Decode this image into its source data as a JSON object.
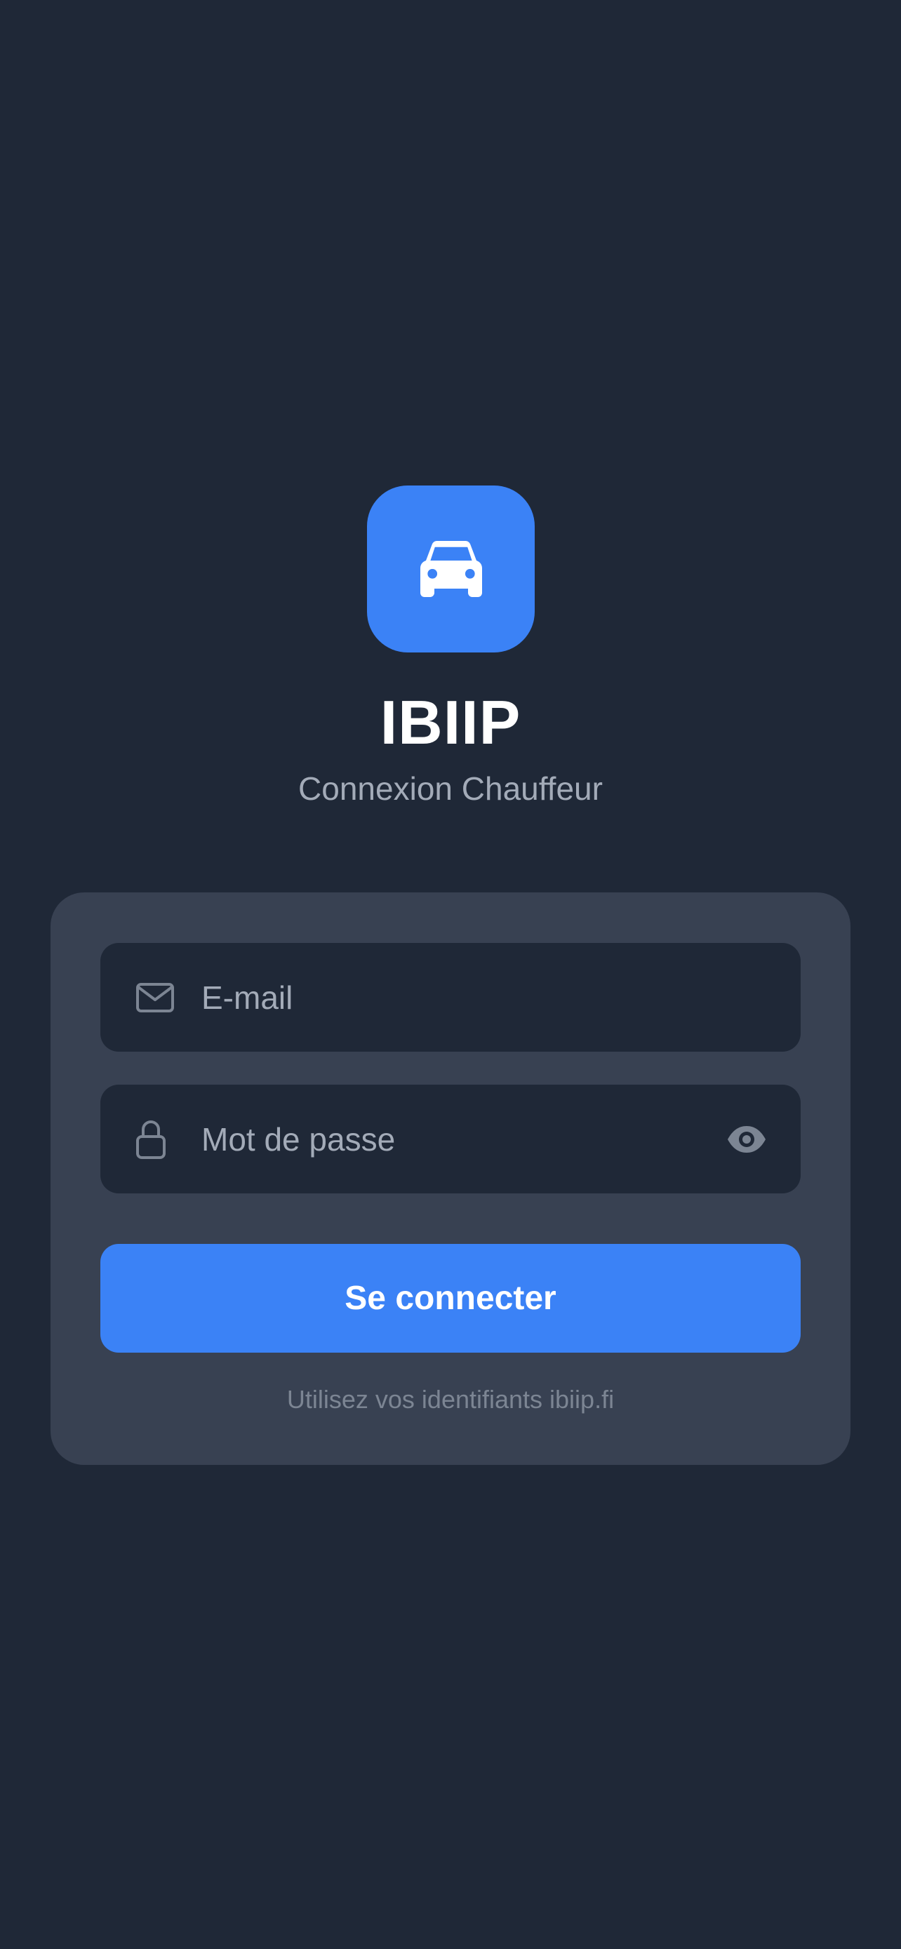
{
  "app": {
    "name": "IBIIP",
    "subtitle": "Connexion Chauffeur",
    "logo_icon": "car-icon"
  },
  "login_form": {
    "email": {
      "icon": "envelope-icon",
      "placeholder": "E-mail",
      "value": ""
    },
    "password": {
      "icon": "lock-icon",
      "placeholder": "Mot de passe",
      "value": "",
      "toggle_icon": "eye-icon"
    },
    "submit_label": "Se connecter",
    "hint": "Utilisez vos identifiants ibiip.fi"
  },
  "colors": {
    "background": "#1f2837",
    "card": "#384152",
    "accent": "#3b82f6",
    "muted_text": "#a3abb8"
  }
}
